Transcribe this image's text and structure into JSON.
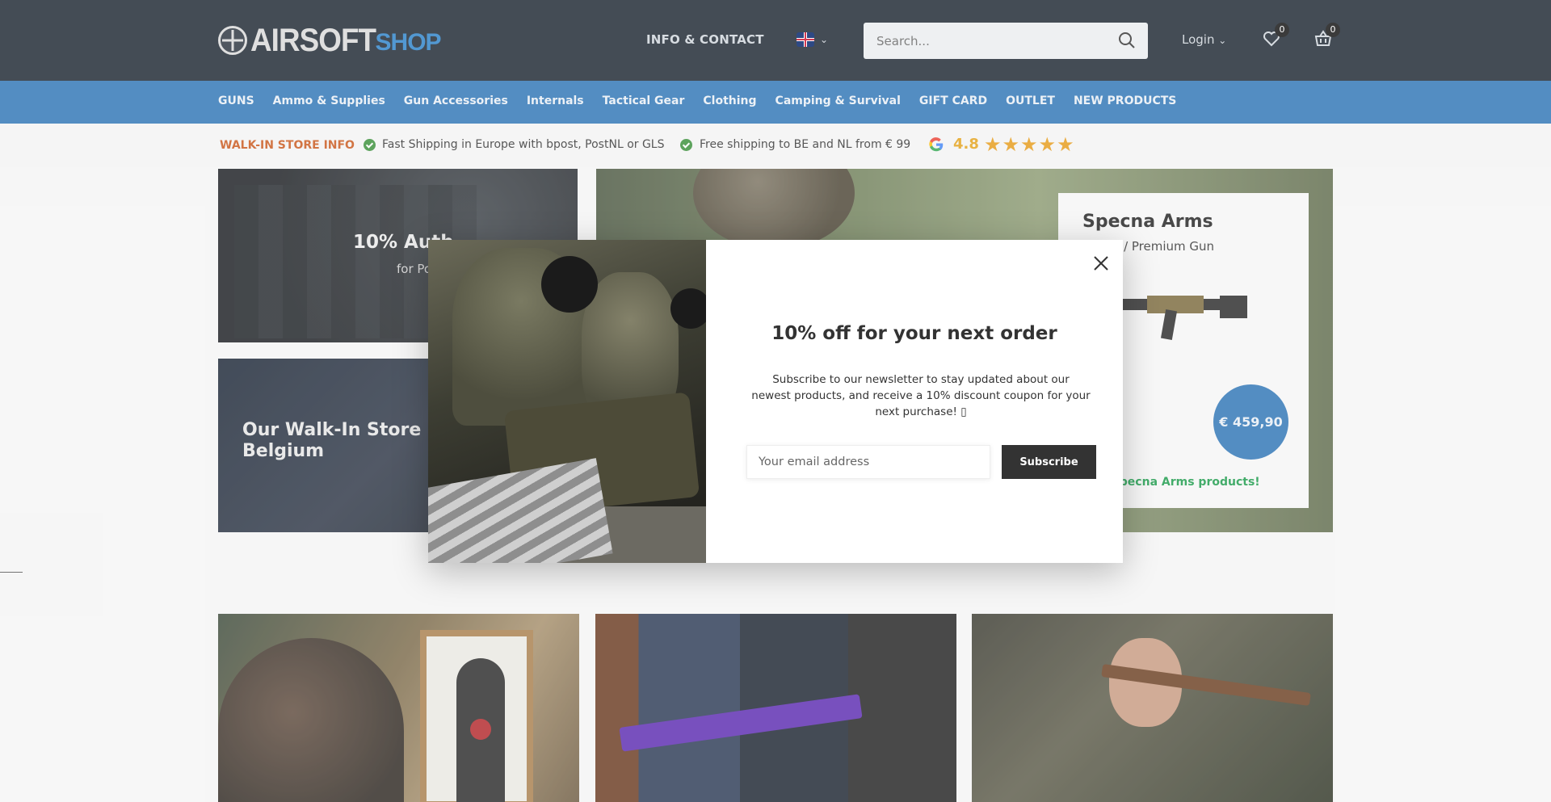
{
  "header": {
    "logo_text_a": "AIRSOFT",
    "logo_text_b": "SHOP",
    "info_contact": "INFO & CONTACT",
    "language_icon": "uk-flag-icon",
    "search_placeholder": "Search...",
    "login_label": "Login",
    "wishlist_count": "0",
    "cart_count": "0"
  },
  "nav": {
    "items": [
      "GUNS",
      "Ammo & Supplies",
      "Gun Accessories",
      "Internals",
      "Tactical Gear",
      "Clothing",
      "Camping & Survival",
      "GIFT CARD",
      "OUTLET",
      "NEW PRODUCTS"
    ]
  },
  "info_strip": {
    "walkin": "WALK-IN STORE INFO",
    "shipping_1": "Fast Shipping in Europe with bpost, PostNL or GLS",
    "shipping_2": "Free shipping to BE and NL from € 99",
    "rating": "4.8",
    "stars": "★★★★★"
  },
  "hero": {
    "tile1_title": "10% Auth",
    "tile1_sub": "for Po",
    "tile2_title": "Our Walk-In Store in Belgium",
    "promo_title": "Specna Arms",
    "promo_sub": "PRIME / Premium Gun",
    "promo_price": "€ 459,90",
    "promo_green": "r all Specna Arms products!"
  },
  "modal": {
    "title": "10% off for your next order",
    "text": "Subscribe to our newsletter to stay updated about our newest products, and receive a 10% discount coupon for your next purchase! ▯",
    "email_placeholder": "Your email address",
    "subscribe_label": "Subscribe"
  },
  "colors": {
    "header_bg": "#1c2530",
    "nav_bg": "#2e74b5",
    "accent_orange": "#c8571c",
    "rating_gold": "#e3a21a",
    "green": "#1a9a4a"
  }
}
